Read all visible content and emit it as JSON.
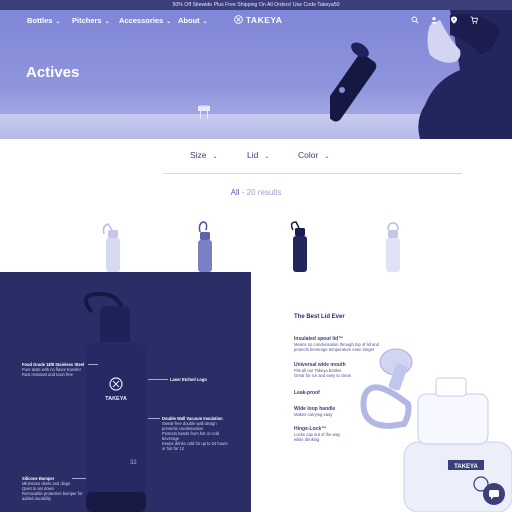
{
  "promo": "50% Off Sitewide Plus Free Shipping On All Orders! Use Code Takeya50",
  "nav": {
    "items": [
      {
        "label": "Bottles"
      },
      {
        "label": "Pitchers"
      },
      {
        "label": "Accessories"
      },
      {
        "label": "About"
      }
    ],
    "logo": "TAKEYA",
    "icons": [
      "search-icon",
      "user-icon",
      "location-icon",
      "cart-icon"
    ]
  },
  "hero": {
    "title": "Actives"
  },
  "filters": [
    {
      "label": "Size"
    },
    {
      "label": "Lid"
    },
    {
      "label": "Color"
    }
  ],
  "results": {
    "all": "All",
    "count": "- 20 results"
  },
  "diagram_left": {
    "bottle_logo": "TAKEYA",
    "bottle_size": "32",
    "annotations": [
      {
        "title": "Food Grade 18/8 Stainless Steel",
        "lines": [
          "Pure taste with no flavor transfer",
          "Rust resistant and toxin free"
        ]
      },
      {
        "title": "Laser Etched Logo",
        "lines": []
      },
      {
        "title": "Double Wall Vacuum Insulation",
        "lines": [
          "Sweat-free double wall design prevents condensation",
          "Protects hands from hot or cold beverage",
          "Keeps drinks cold for up to 24 hours or hot for 12"
        ]
      },
      {
        "title": "Silicone Bumper",
        "lines": [
          "Minimizes dents and dings",
          "Quiet to set down",
          "Removable protective bumper for added durability"
        ]
      }
    ]
  },
  "diagram_right": {
    "title": "The Best Lid Ever",
    "features": [
      {
        "title": "Insulated spout lid™",
        "desc": [
          "Means no condensation through top of lid and",
          "protects beverage temperature even longer"
        ]
      },
      {
        "title": "Universal wide mouth",
        "desc": [
          "Fits all our Takeya bottles.",
          "Great for ice and easy to clean"
        ]
      },
      {
        "title": "Leak-proof",
        "desc": []
      },
      {
        "title": "Wide loop handle",
        "desc": [
          "Makes carrying easy"
        ]
      },
      {
        "title": "Hinge-Lock™",
        "desc": [
          "Locks cap out of the way",
          "while drinking"
        ]
      }
    ],
    "bottle_logo": "TAKEYA"
  },
  "colors": {
    "brand": "#3b3f7a",
    "panel_dark": "#2b2e66",
    "accent_light": "#9a9ed0"
  }
}
